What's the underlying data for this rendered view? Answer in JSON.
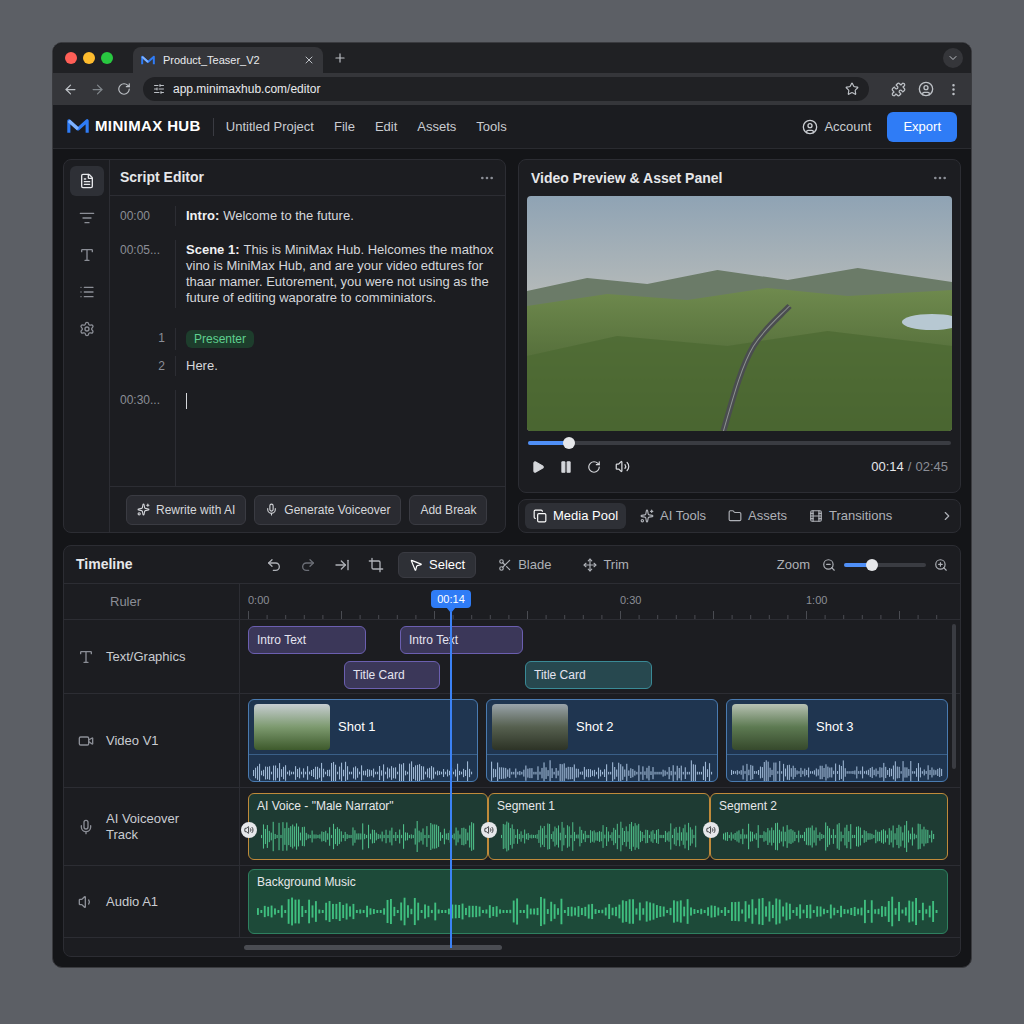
{
  "browser": {
    "tab_title": "Product_Teaser_V2",
    "url": "app.minimaxhub.com/editor"
  },
  "app": {
    "brand": "MINIMAX HUB",
    "menu": [
      "Untitled Project",
      "File",
      "Edit",
      "Assets",
      "Tools"
    ],
    "account": "Account",
    "export": "Export"
  },
  "script_editor": {
    "title": "Script Editor",
    "rail": [
      {
        "selected": true
      },
      {
        "selected": false
      },
      {
        "selected": false
      },
      {
        "selected": false
      },
      {
        "selected": false
      }
    ],
    "rows": [
      {
        "kind": "cue",
        "time": "00:00",
        "label": "Intro:",
        "text": "Welcome to the future."
      },
      {
        "kind": "cue",
        "time": "00:05...",
        "label": "Scene 1:",
        "text": "This is MiniMax Hub. Helcomes the mathox vino is MiniMax Hub, and are your video edtures for thaar mamer. Eutorement, you were not using as the future of editing waporatre to comminiators."
      },
      {
        "kind": "tag",
        "number": "1",
        "tag": "Presenter"
      },
      {
        "kind": "line",
        "number": "2",
        "text": "Here."
      },
      {
        "kind": "cursor",
        "time": "00:30..."
      }
    ],
    "buttons": [
      "Rewrite with AI",
      "Generate Voiceover",
      "Add Break"
    ]
  },
  "preview": {
    "title": "Video Preview & Asset Panel",
    "level": 0.097,
    "current": "00:14",
    "separator": "/",
    "duration": "02:45"
  },
  "asset_tabs": [
    {
      "label": "Media Pool",
      "selected": true
    },
    {
      "label": "AI Tools",
      "selected": false
    },
    {
      "label": "Assets",
      "selected": false
    },
    {
      "label": "Transitions",
      "selected": false
    }
  ],
  "timeline": {
    "title": "Timeline",
    "tools": [
      {
        "label": "Select",
        "selected": true
      },
      {
        "label": "Blade",
        "selected": false
      },
      {
        "label": "Trim",
        "selected": false
      }
    ],
    "zoom": {
      "label": "Zoom",
      "level": 0.34
    },
    "ruler": {
      "label": "Ruler",
      "ticks": [
        "0:00",
        "0:30",
        "1:00"
      ]
    },
    "playhead": "00:14",
    "tracks": [
      {
        "name": "Text/Graphics",
        "kind": "text",
        "clips": [
          {
            "label": "Intro Text",
            "color": "#6b5fb0"
          },
          {
            "label": "Intro Text",
            "color": "#6b5fb0"
          },
          {
            "label": "Title Card",
            "color": "#6b5fb0"
          },
          {
            "label": "Title Card",
            "color": "#3a8a96"
          }
        ]
      },
      {
        "name": "Video V1",
        "kind": "video",
        "clips": [
          {
            "label": "Shot 1"
          },
          {
            "label": "Shot 2"
          },
          {
            "label": "Shot 3"
          }
        ]
      },
      {
        "name": "AI Voiceover Track",
        "kind": "voice",
        "clips": [
          {
            "label": "AI Voice - \"Male Narrator\""
          },
          {
            "label": "Segment 1"
          },
          {
            "label": "Segment 2"
          }
        ]
      },
      {
        "name": "Audio A1",
        "kind": "audio",
        "clips": [
          {
            "label": "Background Music"
          }
        ]
      }
    ]
  }
}
